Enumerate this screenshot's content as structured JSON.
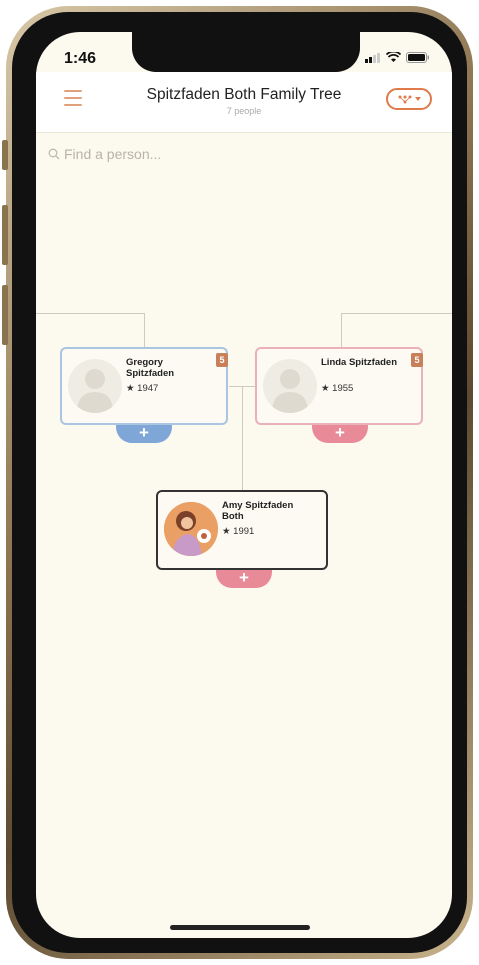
{
  "status_bar": {
    "time": "1:46"
  },
  "header": {
    "title": "Spitzfaden Both Family Tree",
    "subtitle": "7 people"
  },
  "search": {
    "placeholder": "Find a person..."
  },
  "people": [
    {
      "name": "Gregory Spitzfaden",
      "year": "1947",
      "badge": "5",
      "gender_color": "#a9c5e2"
    },
    {
      "name": "Linda Spitzfaden",
      "year": "1955",
      "badge": "5",
      "gender_color": "#eab2b8"
    },
    {
      "name": "Amy Spitzfaden Both",
      "year": "1991"
    }
  ],
  "add_symbol": "+",
  "colors": {
    "accent": "#e07a4a",
    "male": "#7ea6d6",
    "female": "#e88a98",
    "background": "#fcf9ee"
  }
}
